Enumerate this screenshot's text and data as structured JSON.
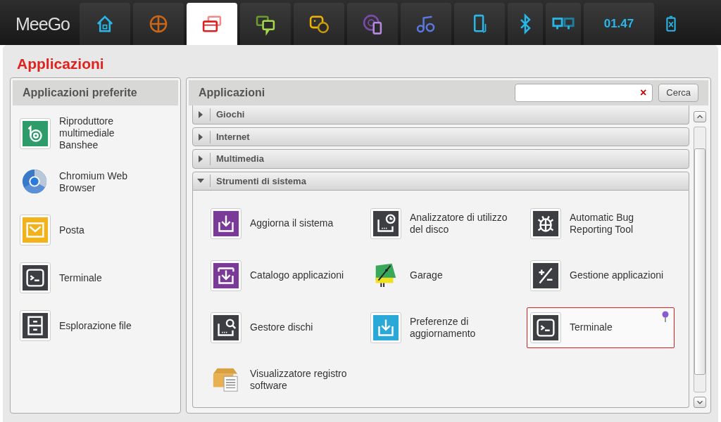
{
  "top_bar": {
    "logo": "MeeGo",
    "tabs": [
      {
        "kind": "home",
        "selected": false
      },
      {
        "kind": "zones",
        "selected": false
      },
      {
        "kind": "applications",
        "selected": true
      },
      {
        "kind": "status",
        "selected": false
      },
      {
        "kind": "people",
        "selected": false
      },
      {
        "kind": "web",
        "selected": false
      },
      {
        "kind": "music",
        "selected": false
      },
      {
        "kind": "devices",
        "selected": false
      },
      {
        "kind": "bluetooth",
        "selected": false
      },
      {
        "kind": "network",
        "selected": false
      }
    ],
    "clock": "01.47",
    "battery": {
      "kind": "battery"
    }
  },
  "page_title": "Applicazioni",
  "favorites": {
    "title": "Applicazioni preferite",
    "items": [
      {
        "label": "Riproduttore multimediale Banshee",
        "kind": "banshee"
      },
      {
        "label": "Chromium Web Browser",
        "kind": "chromium"
      },
      {
        "label": "Posta",
        "kind": "mail"
      },
      {
        "label": "Terminale",
        "kind": "terminal"
      },
      {
        "label": "Esplorazione file",
        "kind": "files"
      }
    ]
  },
  "applications": {
    "title": "Applicazioni",
    "search": {
      "clear": "×",
      "button": "Cerca"
    },
    "categories": [
      {
        "label": "Giochi",
        "expanded": false
      },
      {
        "label": "Internet",
        "expanded": false
      },
      {
        "label": "Multimedia",
        "expanded": false
      },
      {
        "label": "Strumenti di sistema",
        "expanded": true,
        "apps": [
          {
            "label": "Aggiorna il sistema",
            "kind": "update",
            "selected": false
          },
          {
            "label": "Analizzatore di utilizzo del disco",
            "kind": "disk-usage",
            "selected": false
          },
          {
            "label": "Automatic Bug Reporting Tool",
            "kind": "bug",
            "selected": false
          },
          {
            "label": "Catalogo applicazioni",
            "kind": "catalog",
            "selected": false
          },
          {
            "label": "Garage",
            "kind": "garage",
            "selected": false
          },
          {
            "label": "Gestione applicazioni",
            "kind": "manage",
            "selected": false
          },
          {
            "label": "Gestore dischi",
            "kind": "disk-search",
            "selected": false
          },
          {
            "label": "Preferenze di aggiornamento",
            "kind": "update-prefs",
            "selected": false
          },
          {
            "label": "Terminale",
            "kind": "terminal",
            "selected": true
          },
          {
            "label": "Visualizzatore registro software",
            "kind": "package",
            "selected": false
          }
        ]
      }
    ]
  }
}
